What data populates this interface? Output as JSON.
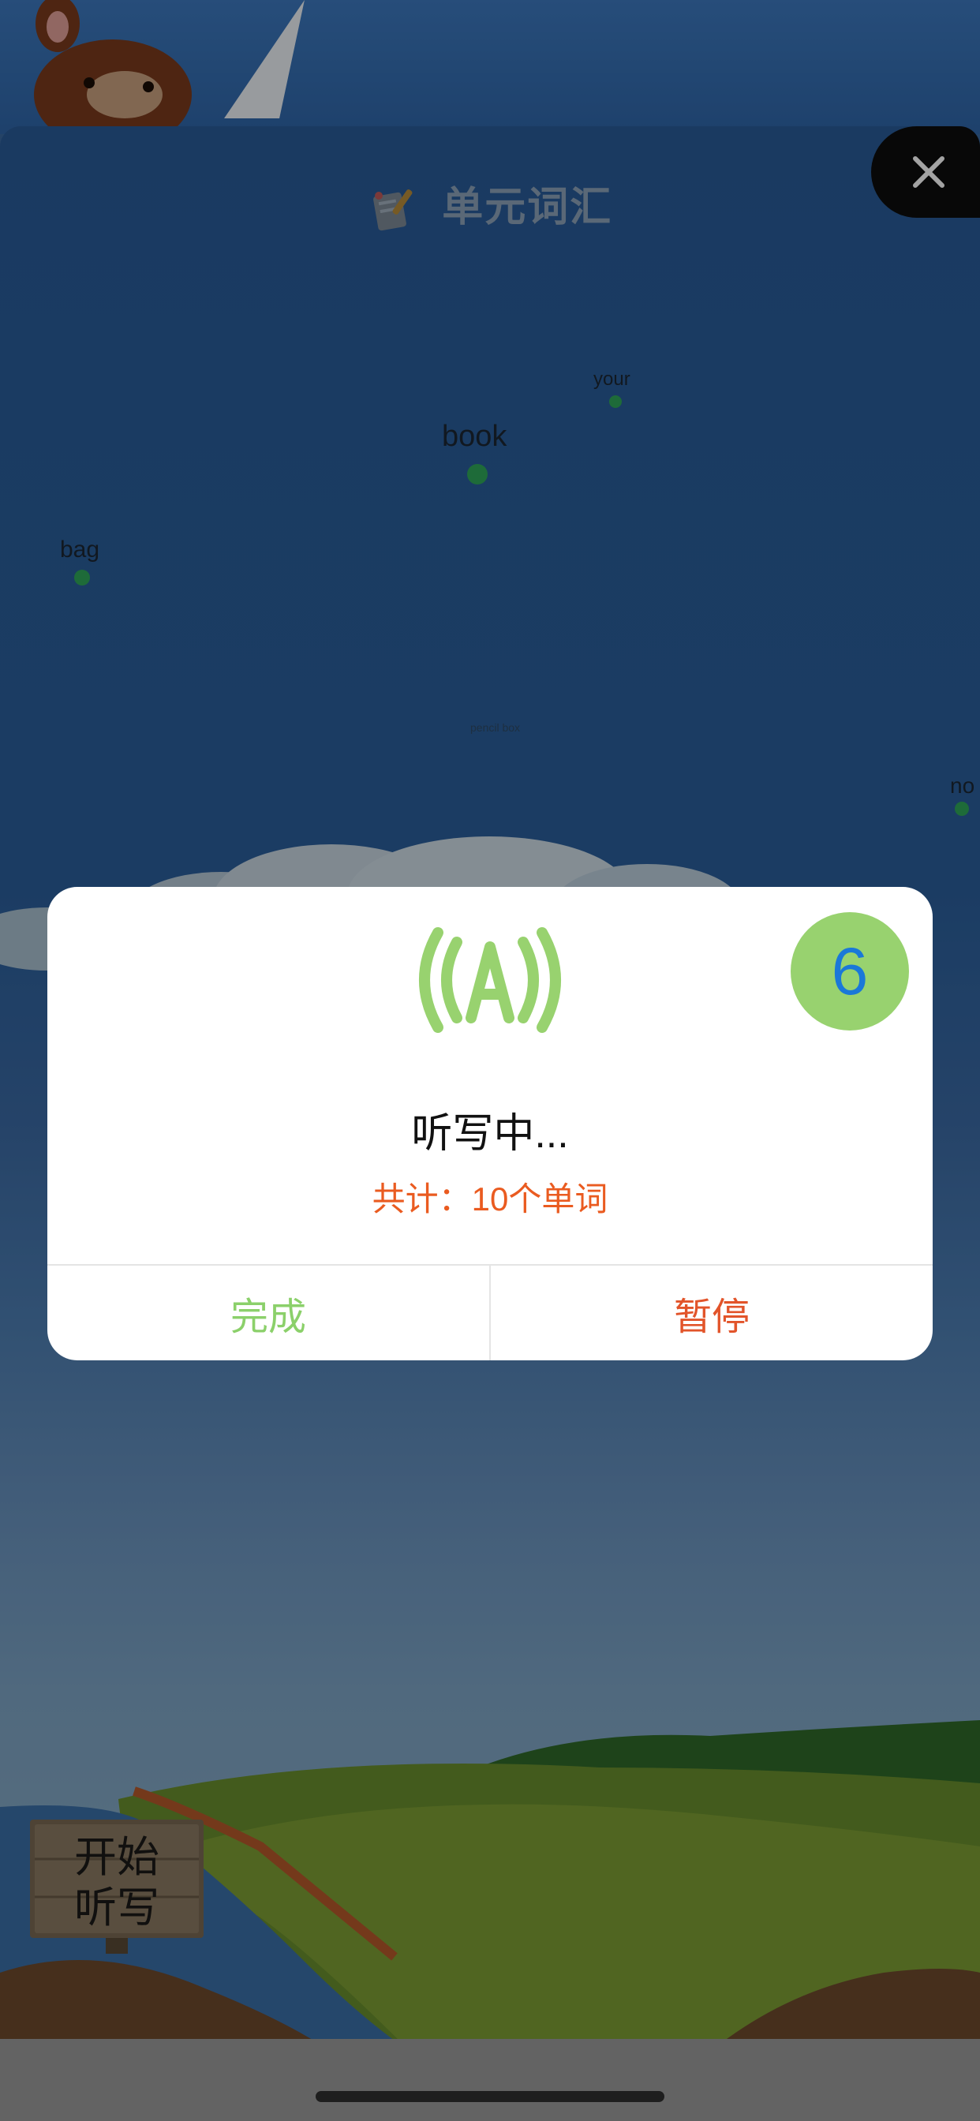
{
  "header": {
    "title": "单元词汇"
  },
  "words": [
    {
      "text": "your"
    },
    {
      "text": "book"
    },
    {
      "text": "bag"
    },
    {
      "text": "pencil box"
    },
    {
      "text": "no"
    }
  ],
  "dialog": {
    "count": "6",
    "status": "听写中...",
    "total": "共计：10个单词",
    "done_label": "完成",
    "pause_label": "暂停",
    "audio_icon": "audio-wave-icon"
  },
  "sign": {
    "line1": "开始",
    "line2": "听写"
  },
  "colors": {
    "accent_green": "#98d26f",
    "count_blue": "#1a78d8",
    "total_orange": "#ea5b20",
    "pause_red": "#e2542a",
    "done_green": "#8bd06a"
  }
}
